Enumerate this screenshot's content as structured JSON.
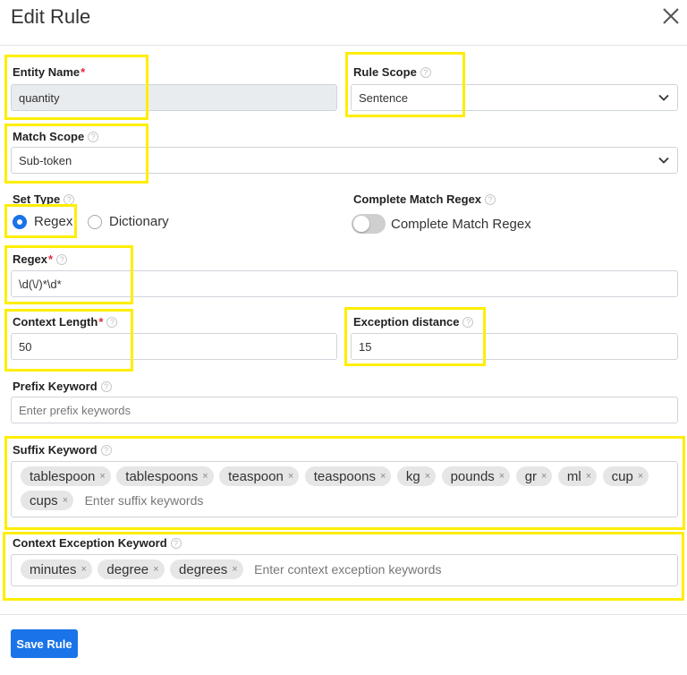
{
  "dialog": {
    "title": "Edit Rule",
    "close_icon": "close-icon"
  },
  "entity_name": {
    "label": "Entity Name",
    "required_mark": "*",
    "value": "quantity"
  },
  "rule_scope": {
    "label": "Rule Scope",
    "help": "?",
    "value": "Sentence"
  },
  "match_scope": {
    "label": "Match Scope",
    "help": "?",
    "value": "Sub-token"
  },
  "set_type": {
    "label": "Set Type",
    "help": "?",
    "options": [
      {
        "label": "Regex",
        "selected": true
      },
      {
        "label": "Dictionary",
        "selected": false
      }
    ]
  },
  "complete_match": {
    "label": "Complete Match Regex",
    "help": "?",
    "toggle_label": "Complete Match Regex",
    "enabled": false
  },
  "regex": {
    "label": "Regex",
    "required_mark": "*",
    "help": "?",
    "value": "\\d(\\/)*\\d*"
  },
  "context_length": {
    "label": "Context Length",
    "required_mark": "*",
    "help": "?",
    "value": "50"
  },
  "exception_distance": {
    "label": "Exception distance",
    "help": "?",
    "value": "15"
  },
  "prefix_keyword": {
    "label": "Prefix Keyword",
    "help": "?",
    "placeholder": "Enter prefix keywords"
  },
  "suffix_keyword": {
    "label": "Suffix Keyword",
    "help": "?",
    "remove_glyph": "×",
    "tags": [
      "tablespoon",
      "tablespoons",
      "teaspoon",
      "teaspoons",
      "kg",
      "pounds",
      "gr",
      "ml",
      "cup",
      "cups"
    ],
    "placeholder": "Enter suffix keywords"
  },
  "context_exception_keyword": {
    "label": "Context Exception Keyword",
    "help": "?",
    "remove_glyph": "×",
    "tags": [
      "minutes",
      "degree",
      "degrees"
    ],
    "placeholder": "Enter context exception keywords"
  },
  "footer": {
    "save_label": "Save Rule"
  },
  "colors": {
    "accent": "#1a73e8",
    "highlight": "#ffee00",
    "required": "#e0283c",
    "disabled_bg": "#e9ecef"
  }
}
